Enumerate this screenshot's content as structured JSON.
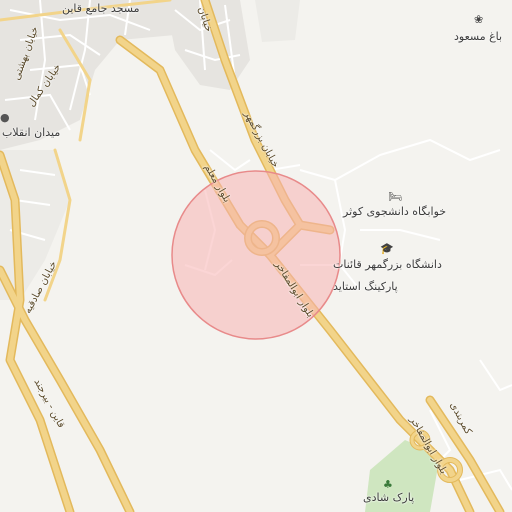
{
  "map": {
    "labels": {
      "mosque": "مسجد جامع قاین",
      "garden": "باغ مسعود",
      "square": "میدان انقلاب",
      "dorm": "خوابگاه دانشجوی کوثر",
      "university": "دانشگاه بزرگمهر قائنات",
      "parking": "پارکینگ استاید",
      "park": "پارک شادی"
    },
    "roads": {
      "r1": "بلوار ابوالمفاخر",
      "r2": "بلوار ابوالمفاخر",
      "r3": "بلوار معلم",
      "r4": "خیابان بزرگمهر",
      "r5": "خیابان",
      "r6": "خیابان کمال",
      "r7": "خیابان بهشتی",
      "r8": "خیابان صادقیه",
      "r9": "قاین - بیرجند",
      "r10": "کمربندی"
    },
    "icons": {
      "garden": "garden-icon",
      "dorm": "bed-icon",
      "university": "graduation-cap-icon",
      "park": "tree-icon",
      "square": "pin-icon"
    },
    "colors": {
      "background": "#f4f3ef",
      "major_road": "#f2d48a",
      "major_road_edge": "#e3b95c",
      "minor_road": "#ffffff",
      "urban_block": "#e7e5e1",
      "park": "#cfe6c0",
      "highlight_fill": "#f7b3b3",
      "highlight_stroke": "#e88a8a"
    }
  }
}
